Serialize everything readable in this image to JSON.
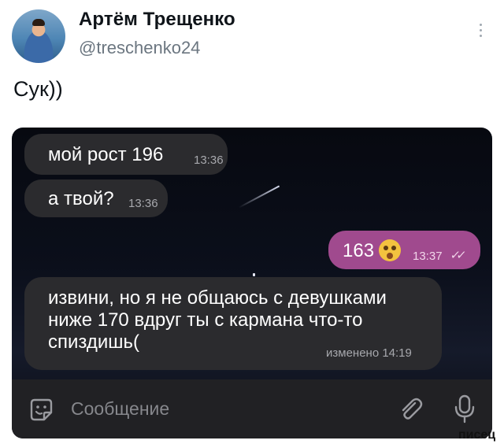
{
  "tweet": {
    "author_name": "Артём Трещенко",
    "author_handle": "@treschenko24",
    "text": "Сук))"
  },
  "chat": {
    "messages": [
      {
        "text": "мой рост 196",
        "time": "13:36",
        "direction": "incoming"
      },
      {
        "text": "а твой?",
        "time": "13:36",
        "direction": "incoming"
      },
      {
        "text": "163",
        "emoji": "flushed-face-with-hands-over-mouth",
        "time": "13:37",
        "status": "read",
        "direction": "outgoing"
      },
      {
        "text": "извини, но я не общаюсь с девушками ниже 170 вдруг ты с кармана что-то спиздишь(",
        "time": "изменено 14:19",
        "direction": "incoming"
      }
    ],
    "composer_placeholder": "Сообщение",
    "colors": {
      "incoming_bubble": "#2b2b2e",
      "outgoing_bubble": "#a04a8e",
      "background": "#0b0f1b"
    }
  },
  "watermark": "писец"
}
